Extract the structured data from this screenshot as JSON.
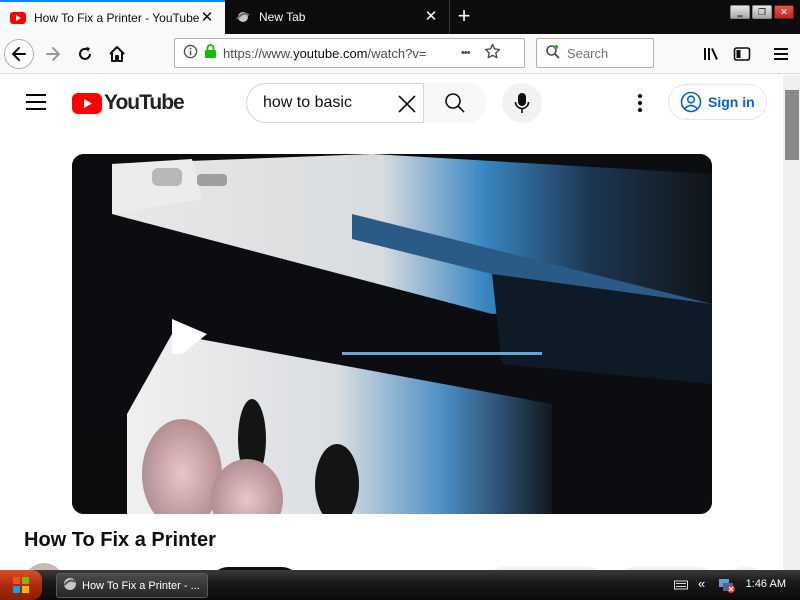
{
  "browser": {
    "tabs": [
      {
        "title": "How To Fix a Printer - YouTube",
        "active": true,
        "favicon": "youtube-favicon"
      },
      {
        "title": "New Tab",
        "active": false,
        "favicon": "newtab-favicon"
      }
    ],
    "new_tab_symbol": "+",
    "close_symbol": "✕",
    "window_buttons": {
      "minimize": "‗",
      "restore": "❐",
      "close": "✕"
    },
    "url": "https://www.youtube.com/watch?v=",
    "url_prefix": "https://www.",
    "url_host": "youtube.com",
    "url_rest": "/watch?v=",
    "search_placeholder": "Search",
    "more_symbol": "•••",
    "colors": {
      "tabstrip": "#0c0c0d",
      "accent": "#0a84ff",
      "toolbar": "#f9f9fa",
      "lock": "#12bc00"
    }
  },
  "youtube": {
    "logo_text": "YouTube",
    "search_query": "how to basic",
    "sign_in_label": "Sign in",
    "video_title": "How To Fix a Printer",
    "colors": {
      "brand_red": "#ff0000",
      "link_blue": "#065fd4"
    }
  },
  "taskbar": {
    "items": [
      {
        "label": "How To Fix a Printer - ...",
        "icon": "firefox-icon"
      }
    ],
    "tray_symbol": "«",
    "clock": "1:46 AM",
    "colors": {
      "start": "#b02a0c",
      "bar": "#1a1a1a"
    }
  }
}
